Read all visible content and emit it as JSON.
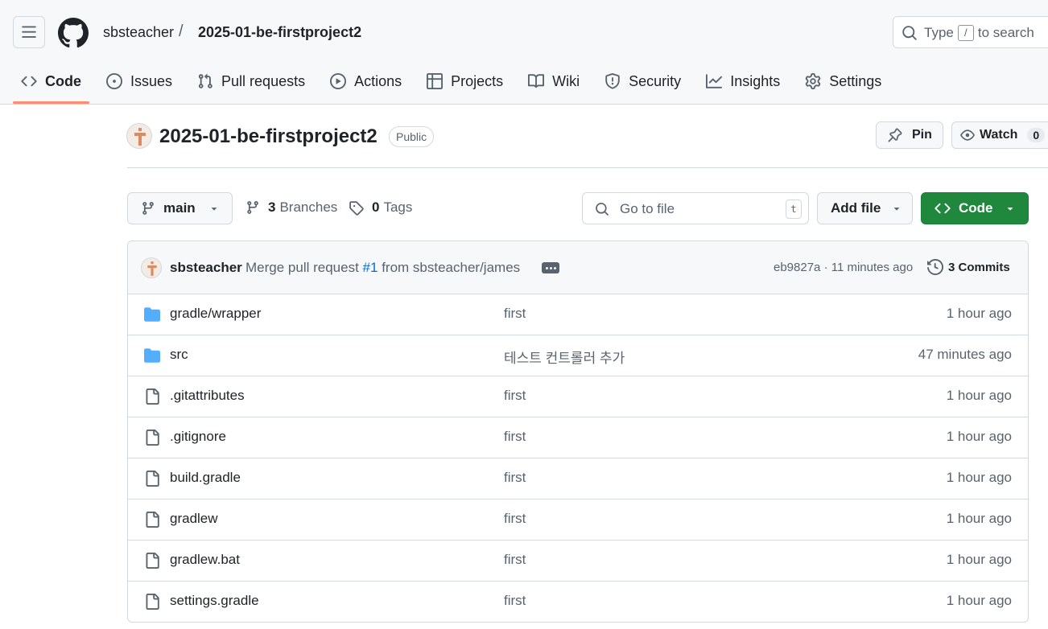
{
  "header": {
    "menu_icon": "hamburger-icon",
    "logo_icon": "github-mark-icon",
    "owner": "sbsteacher",
    "separator": "/",
    "repo": "2025-01-be-firstproject2",
    "search": {
      "prefix": "Type",
      "key": "/",
      "suffix": "to search"
    }
  },
  "tabs": [
    {
      "label": "Code",
      "icon": "code-icon",
      "active": true
    },
    {
      "label": "Issues",
      "icon": "issue-circle-icon"
    },
    {
      "label": "Pull requests",
      "icon": "pull-request-icon"
    },
    {
      "label": "Actions",
      "icon": "play-circle-icon"
    },
    {
      "label": "Projects",
      "icon": "table-icon"
    },
    {
      "label": "Wiki",
      "icon": "book-icon"
    },
    {
      "label": "Security",
      "icon": "shield-icon"
    },
    {
      "label": "Insights",
      "icon": "graph-icon"
    },
    {
      "label": "Settings",
      "icon": "gear-icon"
    }
  ],
  "repo": {
    "name": "2025-01-be-firstproject2",
    "visibility": "Public",
    "pin_label": "Pin",
    "watch_label": "Watch",
    "watch_count": "0"
  },
  "filenav": {
    "branch": "main",
    "branches_count": "3",
    "branches_label": "Branches",
    "tags_count": "0",
    "tags_label": "Tags",
    "goto_placeholder": "Go to file",
    "goto_key": "t",
    "add_file_label": "Add file",
    "code_label": "Code"
  },
  "commit": {
    "author": "sbsteacher",
    "message_prefix": "Merge pull request",
    "pr_link": "#1",
    "message_suffix": "from sbsteacher/james",
    "meta": "eb9827a · 11 minutes ago",
    "commits_label": "3 Commits"
  },
  "files": [
    {
      "type": "folder",
      "icon": "folder-icon",
      "name": "gradle/wrapper",
      "message": "first",
      "time": "1 hour ago"
    },
    {
      "type": "folder",
      "icon": "folder-icon",
      "name": "src",
      "message": "테스트 컨트롤러 추가",
      "time": "47 minutes ago"
    },
    {
      "type": "file",
      "icon": "file-icon",
      "name": ".gitattributes",
      "message": "first",
      "time": "1 hour ago"
    },
    {
      "type": "file",
      "icon": "file-icon",
      "name": ".gitignore",
      "message": "first",
      "time": "1 hour ago"
    },
    {
      "type": "file",
      "icon": "file-icon",
      "name": "build.gradle",
      "message": "first",
      "time": "1 hour ago"
    },
    {
      "type": "file",
      "icon": "file-icon",
      "name": "gradlew",
      "message": "first",
      "time": "1 hour ago"
    },
    {
      "type": "file",
      "icon": "file-icon",
      "name": "gradlew.bat",
      "message": "first",
      "time": "1 hour ago"
    },
    {
      "type": "file",
      "icon": "file-icon",
      "name": "settings.gradle",
      "message": "first",
      "time": "1 hour ago"
    }
  ],
  "colors": {
    "accent_underline": "#fd8c73",
    "primary_button": "#1f883d",
    "link": "#0969da",
    "folder": "#54aeff"
  }
}
